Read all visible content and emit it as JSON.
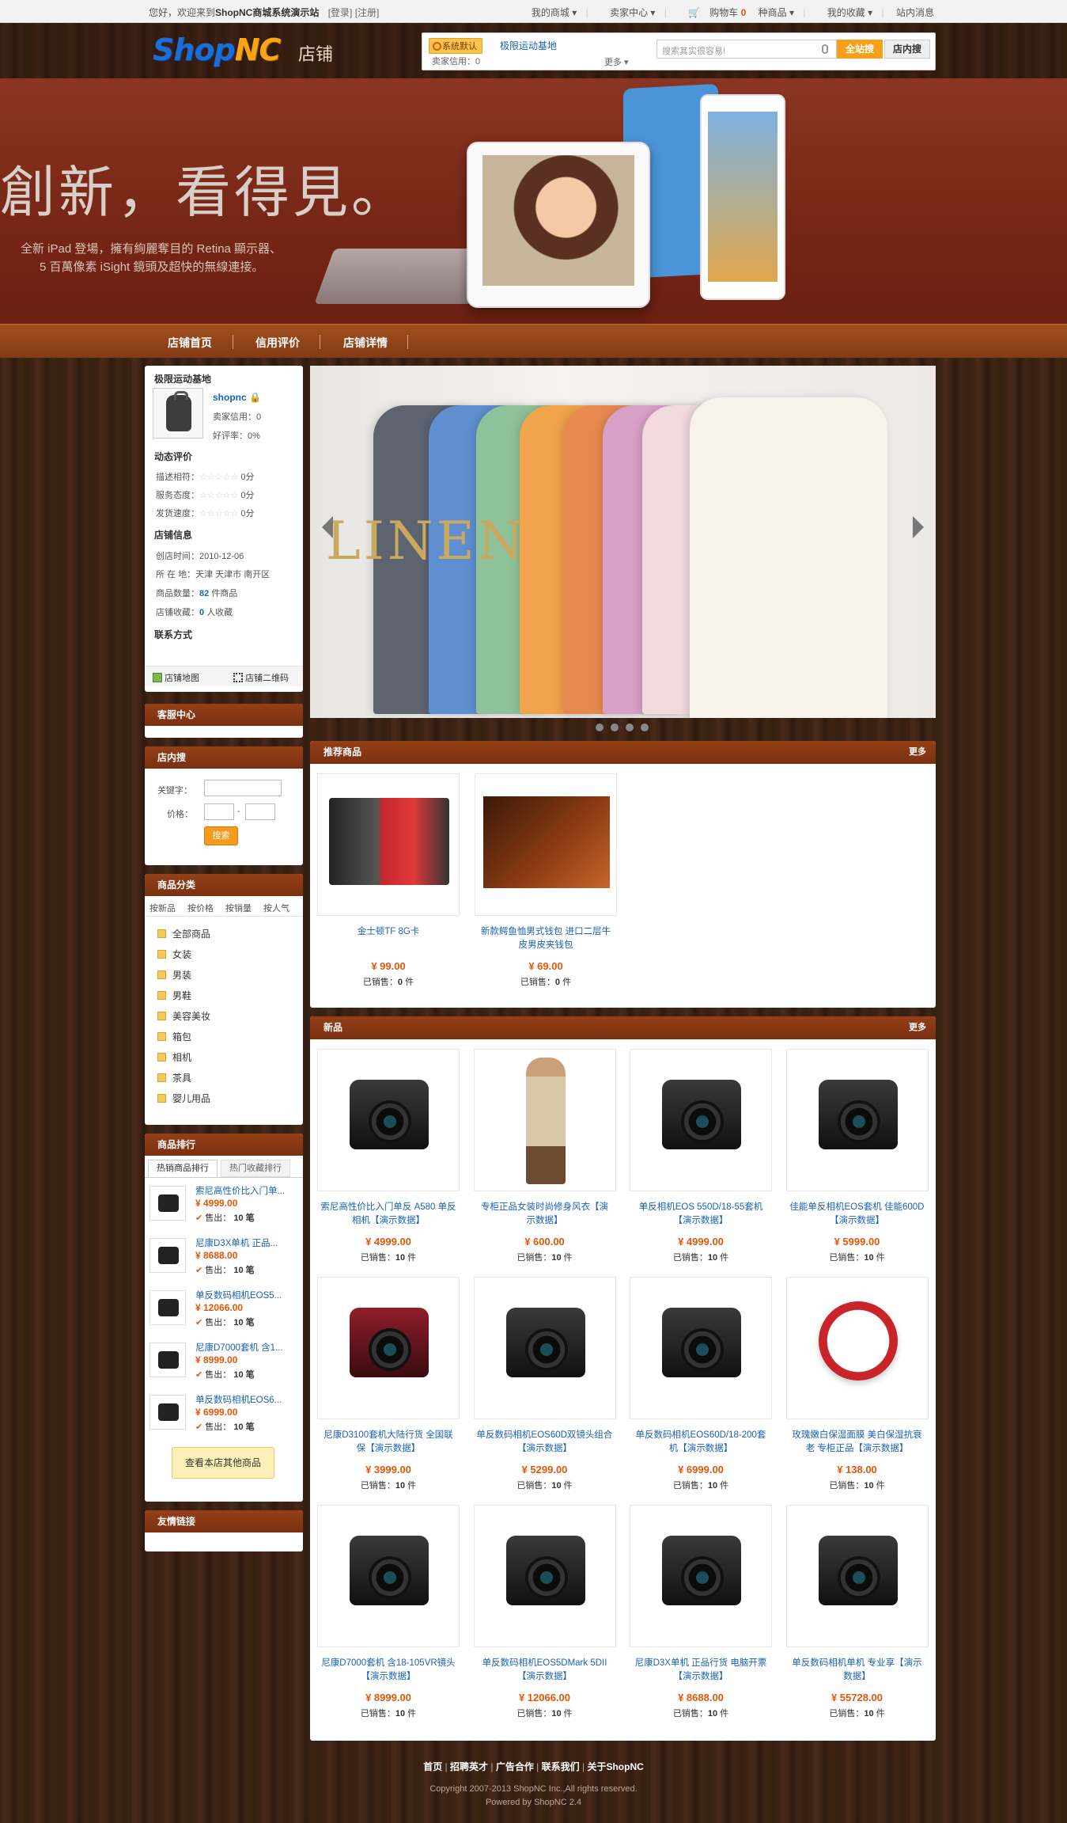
{
  "topbar": {
    "welcome": "您好，欢迎来到",
    "site": "ShopNC商城系统演示站",
    "login": "[登录]",
    "register": "[注册]",
    "links": [
      "我的商城",
      "卖家中心",
      "购物车",
      "0",
      "种商品",
      "我的收藏",
      "站内消息"
    ]
  },
  "header": {
    "logo_shop": "Shop",
    "logo_nc": "NC",
    "logo_sub": "店铺",
    "shop_badge": "系统默认",
    "shop_name": "极限运动基地",
    "seller_credit": "卖家信用：0",
    "more": "更多",
    "search_placeholder": "搜索其实很容易!",
    "btn_all": "全站搜",
    "btn_shop": "店内搜"
  },
  "banner": {
    "slogan": "創新，看得見。",
    "line1": "全新 iPad 登場，擁有絢麗奪目的 Retina 顯示器、",
    "line2": "5 百萬像素 iSight 鏡頭及超快的無線連接。"
  },
  "nav": [
    "店铺首页",
    "信用评价",
    "店铺详情"
  ],
  "shopinfo": {
    "title": "极限运动基地",
    "owner": "shopnc",
    "credit": "卖家信用：0",
    "rate": "好评率：0%",
    "dyn": "动态评价",
    "r1": "描述相符：",
    "r2": "服务态度：",
    "r3": "发货速度：",
    "score": "0分",
    "info": "店铺信息",
    "created": "创店时间：2010-12-06",
    "loc": "所 在 地：天津 天津市 南开区",
    "goods_label": "商品数量：",
    "goods_num": "82",
    "goods_unit": "件商品",
    "fav_label": "店铺收藏：",
    "fav_num": "0",
    "fav_unit": "人收藏",
    "contact": "联系方式",
    "map": "店铺地图",
    "qr": "店铺二维码"
  },
  "service": {
    "title": "客服中心"
  },
  "search": {
    "title": "店内搜",
    "kw": "关键字：",
    "price": "价格：",
    "dash": "-",
    "btn": "搜索"
  },
  "category": {
    "title": "商品分类",
    "tabs": [
      "按新品",
      "按价格",
      "按销量",
      "按人气"
    ],
    "items": [
      "全部商品",
      "女装",
      "男装",
      "男鞋",
      "美容美妆",
      "箱包",
      "相机",
      "茶具",
      "婴儿用品"
    ]
  },
  "ranking": {
    "title": "商品排行",
    "tabs": [
      "热销商品排行",
      "热门收藏排行"
    ],
    "sold_label": "售出：",
    "sold_unit": "笔",
    "items": [
      {
        "name": "索尼高性价比入门单...",
        "price": "¥ 4999.00",
        "sold": "10"
      },
      {
        "name": "尼康D3X单机 正品...",
        "price": "¥ 8688.00",
        "sold": "10"
      },
      {
        "name": "单反数码相机EOS5...",
        "price": "¥ 12066.00",
        "sold": "10"
      },
      {
        "name": "尼康D7000套机 含1...",
        "price": "¥ 8999.00",
        "sold": "10"
      },
      {
        "name": "单反数码相机EOS6...",
        "price": "¥ 6999.00",
        "sold": "10"
      }
    ],
    "more_btn": "查看本店其他商品"
  },
  "links": {
    "title": "友情链接"
  },
  "slider": {
    "text": "LINEN"
  },
  "recommend": {
    "title": "推荐商品",
    "more": "更多",
    "sold_label": "已销售：",
    "sold_unit": "件",
    "items": [
      {
        "name": "金士顿TF 8G卡",
        "price": "¥ 99.00",
        "sold": "0"
      },
      {
        "name": "新款鳄鱼恤男式钱包 进口二层牛皮男皮夹钱包",
        "price": "¥ 69.00",
        "sold": "0"
      }
    ]
  },
  "newitems": {
    "title": "新品",
    "more": "更多",
    "sold_label": "已销售：",
    "sold_unit": "件",
    "items": [
      {
        "name": "索尼高性价比入门单反 A580 单反相机【演示数据】",
        "price": "¥ 4999.00",
        "sold": "10"
      },
      {
        "name": "专柜正品女装时尚修身风衣【演示数据】",
        "price": "¥ 600.00",
        "sold": "10"
      },
      {
        "name": "单反相机EOS 550D/18-55套机【演示数据】",
        "price": "¥ 4999.00",
        "sold": "10"
      },
      {
        "name": "佳能单反相机EOS套机 佳能600D【演示数据】",
        "price": "¥ 5999.00",
        "sold": "10"
      },
      {
        "name": "尼康D3100套机大陆行货 全国联保【演示数据】",
        "price": "¥ 3999.00",
        "sold": "10"
      },
      {
        "name": "单反数码相机EOS60D双镜头组合【演示数据】",
        "price": "¥ 5299.00",
        "sold": "10"
      },
      {
        "name": "单反数码相机EOS60D/18-200套机【演示数据】",
        "price": "¥ 6999.00",
        "sold": "10"
      },
      {
        "name": "玫瑰嫩白保湿面膜 美白保湿抗衰老 专柜正品【演示数据】",
        "price": "¥ 138.00",
        "sold": "10"
      },
      {
        "name": "尼康D7000套机 含18-105VR镜头【演示数据】",
        "price": "¥ 8999.00",
        "sold": "10"
      },
      {
        "name": "单反数码相机EOS5DMark 5DII【演示数据】",
        "price": "¥ 12066.00",
        "sold": "10"
      },
      {
        "name": "尼康D3X单机 正品行货 电脑开票【演示数据】",
        "price": "¥ 8688.00",
        "sold": "10"
      },
      {
        "name": "单反数码相机单机 专业享【演示数据】",
        "price": "¥ 55728.00",
        "sold": "10"
      }
    ]
  },
  "footer": {
    "links": [
      "首页",
      "招聘英才",
      "广告合作",
      "联系我们",
      "关于ShopNC"
    ],
    "copyright": "Copyright 2007-2013 ShopNC Inc.,All rights reserved.",
    "powered": "Powered by ShopNC 2.4"
  }
}
